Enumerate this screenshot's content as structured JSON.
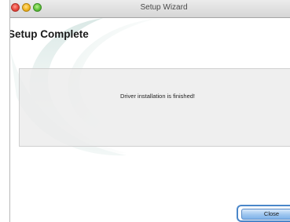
{
  "window": {
    "title": "Setup Wizard"
  },
  "page": {
    "heading": "Setup Complete",
    "message": "Driver installation is finished!"
  },
  "buttons": {
    "close_label": "Close"
  },
  "colors": {
    "accent": "#4a86c9",
    "button_fill": "#9ec6ef",
    "panel_background": "#ebebeb"
  },
  "icons": {
    "close": "window-close-icon",
    "minimize": "window-minimize-icon",
    "zoom": "window-zoom-icon"
  }
}
